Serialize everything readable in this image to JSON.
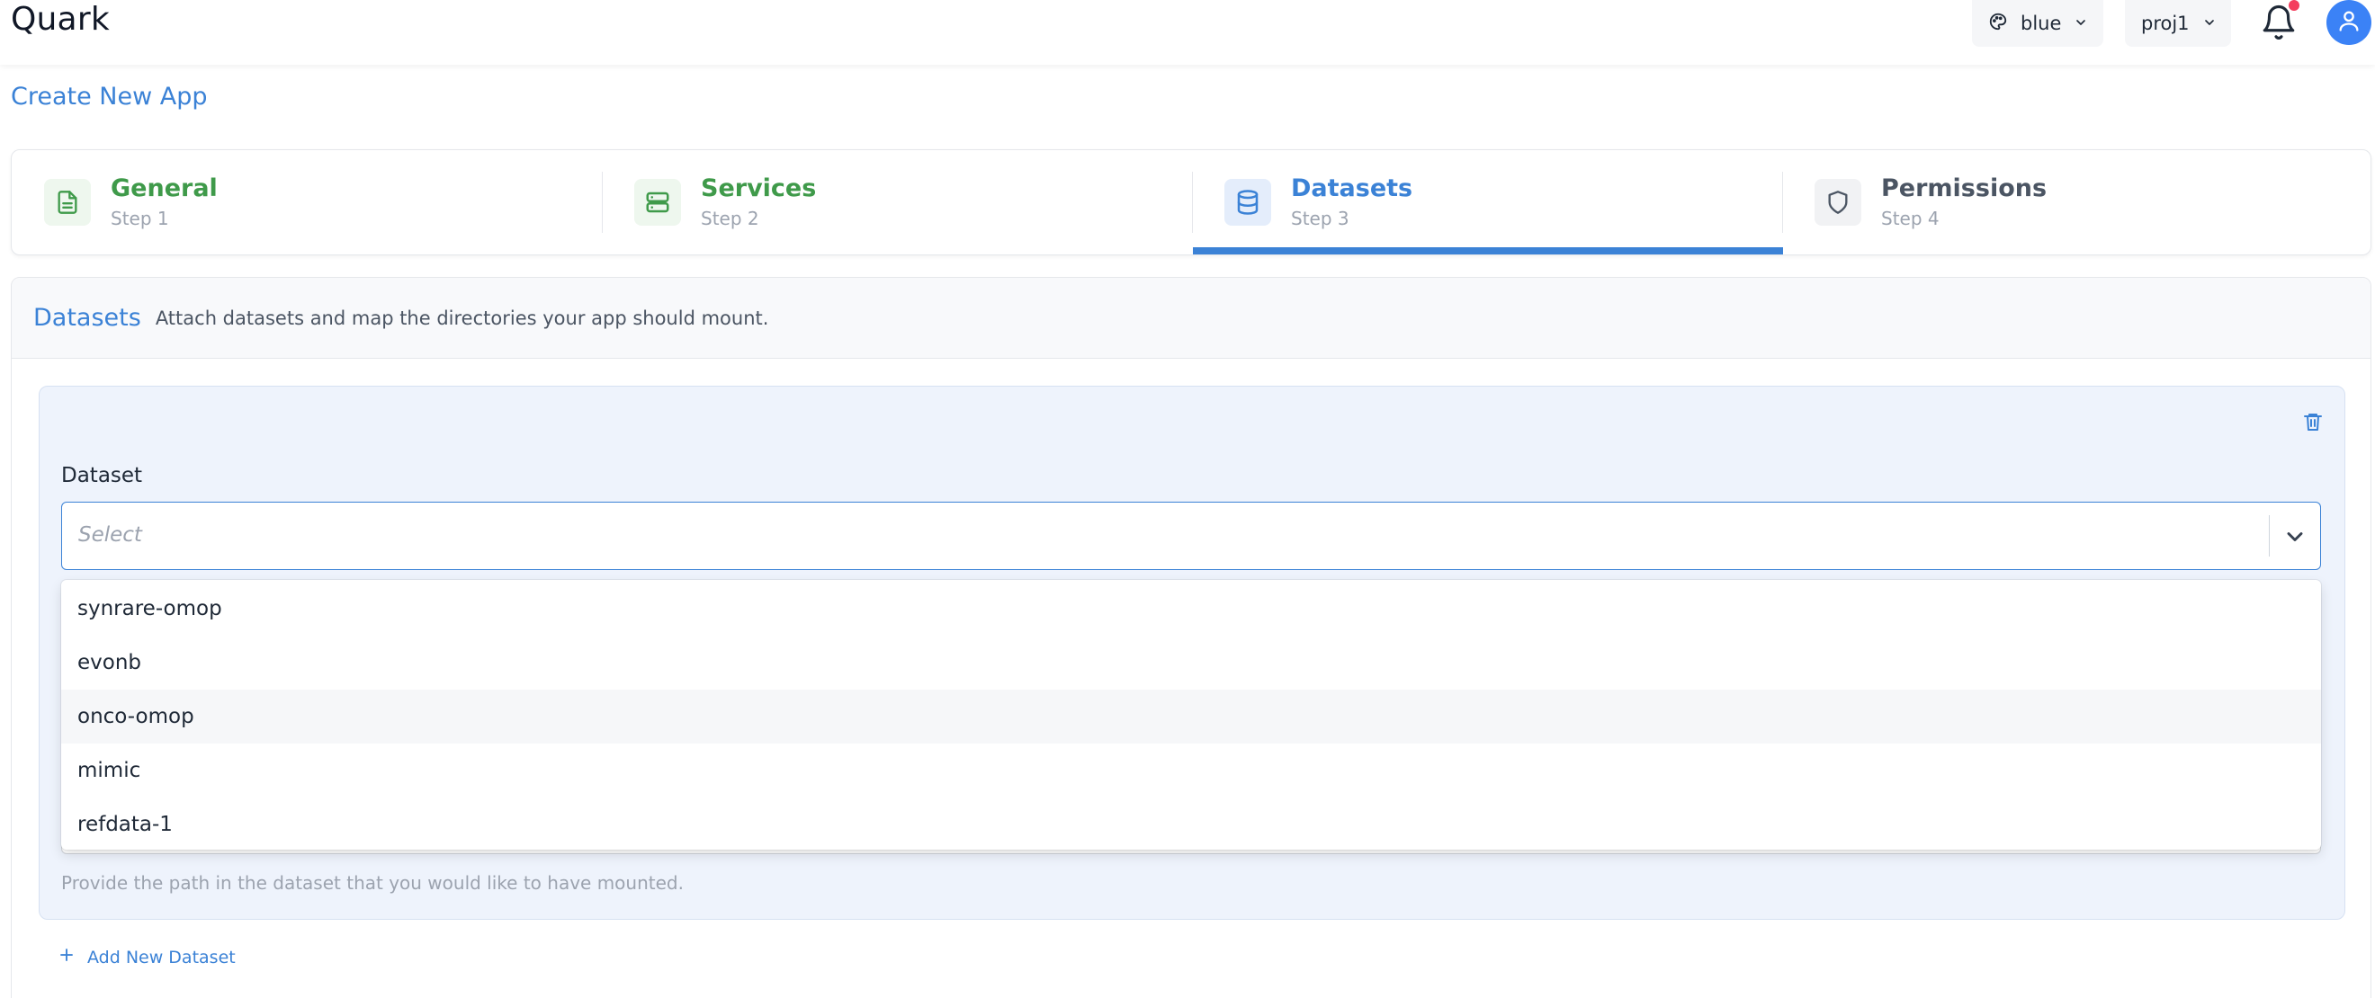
{
  "header": {
    "brand": "Quark",
    "theme_select": {
      "value": "blue"
    },
    "project_select": {
      "value": "proj1"
    },
    "notifications": {
      "has_unread": true
    },
    "colors": {
      "accent": "#3b82d6",
      "badge": "#f43f5e",
      "avatar": "#3b82f6"
    }
  },
  "page": {
    "title": "Create New App"
  },
  "stepper": {
    "steps": [
      {
        "title": "General",
        "sub": "Step 1",
        "state": "done",
        "icon": "file-text-icon"
      },
      {
        "title": "Services",
        "sub": "Step 2",
        "state": "done",
        "icon": "server-icon"
      },
      {
        "title": "Datasets",
        "sub": "Step 3",
        "state": "active",
        "icon": "database-icon"
      },
      {
        "title": "Permissions",
        "sub": "Step 4",
        "state": "todo",
        "icon": "shield-icon"
      }
    ]
  },
  "datasets_panel": {
    "title": "Datasets",
    "description": "Attach datasets and map the directories your app should mount.",
    "card": {
      "dataset_label": "Dataset",
      "dataset_placeholder": "Select",
      "path_help": "Provide the path in the dataset that you would like to have mounted."
    },
    "add_label": "Add New Dataset"
  },
  "dropdown": {
    "options": [
      "synrare-omop",
      "evonb",
      "onco-omop",
      "mimic",
      "refdata-1"
    ],
    "hovered": "onco-omop"
  }
}
